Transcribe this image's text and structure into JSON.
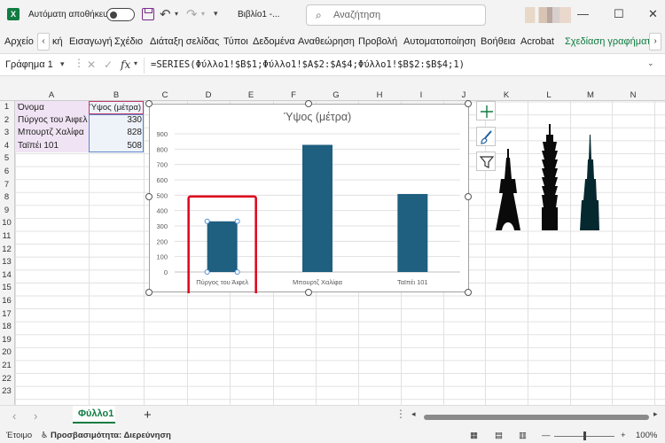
{
  "titlebar": {
    "app_icon_letter": "X",
    "autosave_label": "Αυτόματη αποθήκευση",
    "document_title": "Βιβλίο1  -...",
    "search_placeholder": "Αναζήτηση",
    "minimize": "—",
    "maximize": "☐",
    "close": "✕"
  },
  "ribbon": {
    "tabs": [
      "Αρχείο",
      "κή",
      "Εισαγωγή",
      "Σχέδιο",
      "Διάταξη σελίδας",
      "Τύποι",
      "Δεδομένα",
      "Αναθεώρηση",
      "Προβολή",
      "Αυτοματοποίηση",
      "Βοήθεια",
      "Acrobat",
      "Σχεδίαση γραφήματ"
    ],
    "scroll_left": "‹",
    "scroll_right": "›",
    "accent_color": "#107c41"
  },
  "formula_bar": {
    "name_box": "Γράφημα 1",
    "fx": "fx",
    "formula": "=SERIES(Φύλλο1!$B$1;Φύλλο1!$A$2:$A$4;Φύλλο1!$B$2:$B$4;1)"
  },
  "grid": {
    "columns": [
      "A",
      "B",
      "C",
      "D",
      "E",
      "F",
      "G",
      "H",
      "I",
      "J",
      "K",
      "L",
      "M",
      "N"
    ],
    "rows": [
      "1",
      "2",
      "3",
      "4",
      "5",
      "6",
      "7",
      "8",
      "9",
      "10",
      "11",
      "12",
      "13",
      "14",
      "15",
      "16",
      "17",
      "18",
      "19",
      "20",
      "21",
      "22",
      "23"
    ],
    "cells": {
      "A1": "Όνομα",
      "B1": "Ύψος (μέτρα)",
      "A2": "Πύργος του Άιφελ",
      "B2": "330",
      "A3": "Μπουρτζ Χαλίφα",
      "B3": "828",
      "A4": "Ταϊπέι 101",
      "B4": "508"
    }
  },
  "chart_data": {
    "type": "bar",
    "title": "Ύψος (μέτρα)",
    "categories": [
      "Πύργος του Άιφελ",
      "Μπουρτζ Χαλίφα",
      "Ταϊπέι 101"
    ],
    "values": [
      330,
      828,
      508
    ],
    "ylim": [
      0,
      900
    ],
    "yticks": [
      0,
      100,
      200,
      300,
      400,
      500,
      600,
      700,
      800,
      900
    ],
    "grid": true,
    "bar_color": "#1f5f80",
    "highlight_color": "#e0001b",
    "highlighted_category": "Πύργος του Άιφελ"
  },
  "chart_tools": [
    "plus-icon",
    "brush-icon",
    "filter-icon"
  ],
  "sheets": {
    "active": "Φύλλο1",
    "add": "+",
    "prev": "‹",
    "next": "›"
  },
  "statusbar": {
    "mode": "Έτοιμο",
    "accessibility": "Προσβασιμότητα: Διερεύνηση",
    "zoom_minus": "—",
    "zoom_plus": "+",
    "zoom": "100%"
  }
}
